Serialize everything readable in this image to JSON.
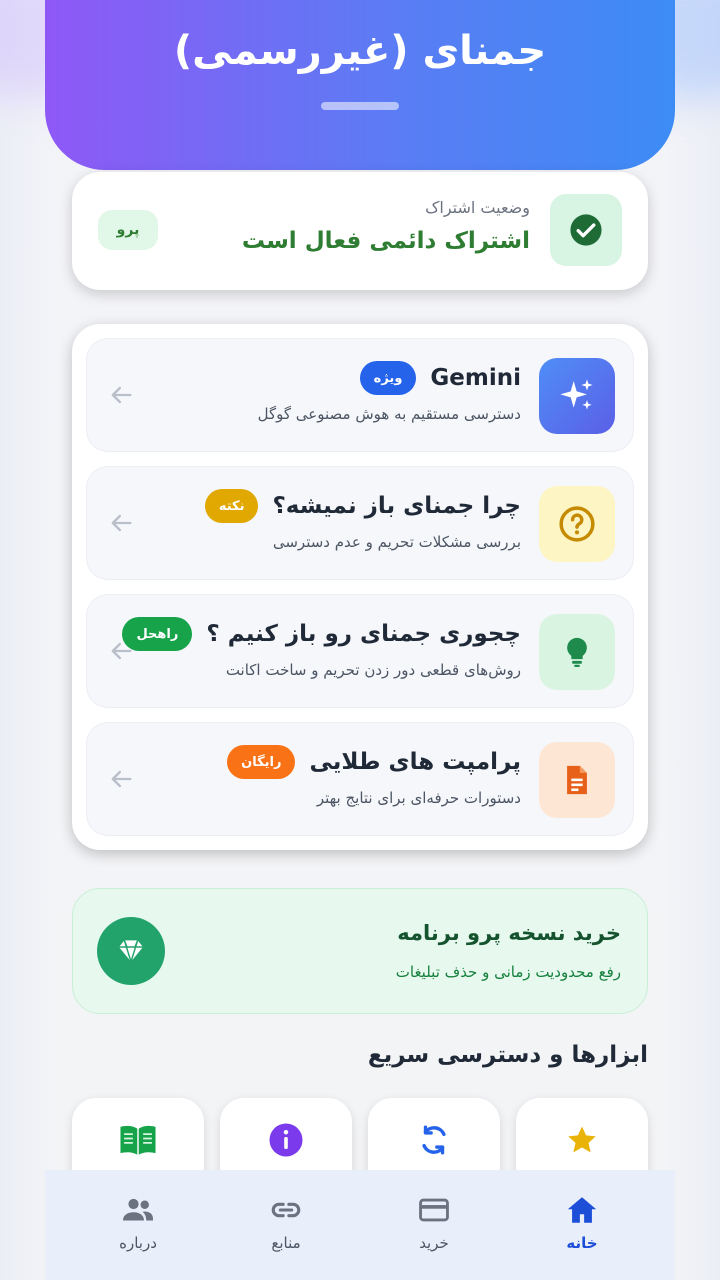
{
  "header": {
    "title": "جمنای (غیررسمی)"
  },
  "subscription": {
    "label": "وضعیت اشتراک",
    "status": "اشتراک دائمی فعال است",
    "badge": "پرو",
    "icon": "check-circle-icon"
  },
  "features": [
    {
      "title": "Gemini",
      "badge": "ویژه",
      "badge_color": "#2563eb",
      "subtitle": "دسترسی مستقیم به هوش مصنوعی گوگل",
      "icon": "sparkle-icon"
    },
    {
      "title": "چرا جمنای باز نمیشه؟",
      "badge": "نکته",
      "badge_color": "#e0a800",
      "subtitle": "بررسی مشکلات تحریم و عدم دسترسی",
      "icon": "question-circle-icon"
    },
    {
      "title": "چجوری جمنای رو باز کنیم ؟",
      "badge": "راهحل",
      "badge_color": "#16a34a",
      "subtitle": "روش‌های قطعی دور زدن تحریم و ساخت اکانت",
      "icon": "lightbulb-icon"
    },
    {
      "title": "پرامپت های طلایی",
      "badge": "رایگان",
      "badge_color": "#f97316",
      "subtitle": "دستورات حرفه‌ای برای نتایج بهتر",
      "icon": "document-icon"
    }
  ],
  "pro": {
    "title": "خرید نسخه پرو برنامه",
    "subtitle": "رفع محدودیت زمانی و حذف تبلیغات",
    "icon": "diamond-icon"
  },
  "tools": {
    "title": "ابزارها و دسترسی سریع",
    "items": [
      {
        "icon": "star-icon"
      },
      {
        "icon": "refresh-icon"
      },
      {
        "icon": "info-icon"
      },
      {
        "icon": "book-icon"
      }
    ]
  },
  "nav": [
    {
      "label": "خانه",
      "icon": "home-icon",
      "active": true
    },
    {
      "label": "خرید",
      "icon": "card-icon",
      "active": false
    },
    {
      "label": "منابع",
      "icon": "link-icon",
      "active": false
    },
    {
      "label": "درباره",
      "icon": "people-icon",
      "active": false
    }
  ],
  "colors": {
    "header_gradient_start": "#8f58f6",
    "header_gradient_end": "#3d8cf5",
    "success": "#2e7d32",
    "nav_active": "#1d4ed8"
  }
}
